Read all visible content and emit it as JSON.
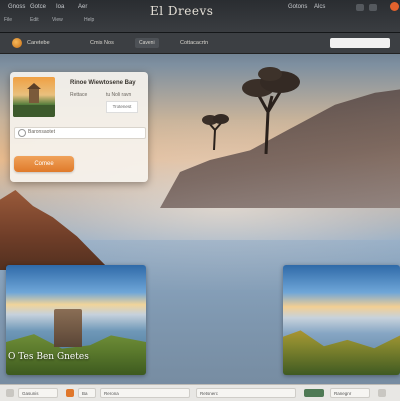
{
  "window": {
    "title": "El Dreevs",
    "left_menu": [
      "Gnoss",
      "Gotce",
      "Ioa",
      "Aer"
    ],
    "left_sub": [
      "File",
      "Edit",
      "View",
      "Help"
    ],
    "right_controls": [
      "Gotons",
      "Alcs"
    ]
  },
  "toolbar": {
    "brand": "Caretebe",
    "items": [
      "Cmis Nos",
      "Caveni",
      "Cottacacrtn"
    ],
    "search_placeholder": ""
  },
  "card": {
    "title": "Rinoe Wiewtosene Bay",
    "subtitle_left": "Rettace",
    "subtitle_right": "tu Noli ravn",
    "badge": "Trotenest",
    "field_label": "Baronsaotet",
    "button_label": "Comee"
  },
  "tiles": {
    "left_caption": "O Tes Ben Gnetes"
  },
  "bottom_bar": {
    "chips": [
      "Gasunis",
      "Ba",
      "Rerona",
      "Retsnerc",
      "Ranegnr"
    ]
  }
}
